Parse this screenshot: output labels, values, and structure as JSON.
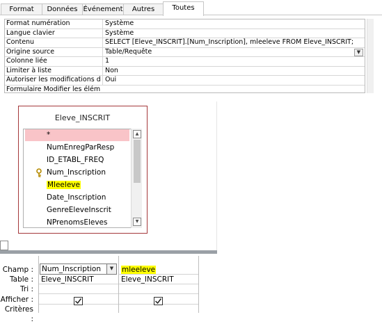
{
  "tabs": [
    {
      "label": "Format",
      "active": false
    },
    {
      "label": "Données",
      "active": false
    },
    {
      "label": "Événement",
      "active": false
    },
    {
      "label": "Autres",
      "active": false
    },
    {
      "label": "Toutes",
      "active": true
    }
  ],
  "properties": [
    {
      "name": "Format numération",
      "value": "Système"
    },
    {
      "name": "Langue clavier",
      "value": "Système"
    },
    {
      "name": "Contenu",
      "value": "SELECT [Eleve_INSCRIT].[Num_Inscription], mleeleve FROM Eleve_INSCRIT;"
    },
    {
      "name": "Origine source",
      "value": "Table/Requête",
      "dropdown": true
    },
    {
      "name": "Colonne liée",
      "value": "1"
    },
    {
      "name": "Limiter à liste",
      "value": "Non"
    },
    {
      "name": "Autoriser les modifications de",
      "value": "Oui"
    },
    {
      "name": "Formulaire Modifier les éléme",
      "value": ""
    }
  ],
  "table": {
    "title": "Eleve_INSCRIT",
    "fields": [
      "*",
      "NumEnregParResp",
      "ID_ETABL_FREQ",
      "Num_Inscription",
      "Mleeleve",
      "Date_Inscription",
      "GenreEleveInscrit",
      "NPrenomsEleves"
    ],
    "key_field": "Num_Inscription",
    "highlighted_field": "Mleeleve"
  },
  "qbe": {
    "row_labels": [
      "Champ :",
      "Table :",
      "Tri :",
      "Afficher :",
      "Critères :"
    ],
    "columns": [
      {
        "field": "Num_Inscription",
        "table": "Eleve_INSCRIT",
        "show": true
      },
      {
        "field": "mleeleve",
        "table": "Eleve_INSCRIT",
        "show": true,
        "highlighted": true
      }
    ]
  },
  "colors": {
    "table_border": "#a4373a",
    "star_row": "#f9c4c8",
    "highlight": "#ffff00"
  }
}
